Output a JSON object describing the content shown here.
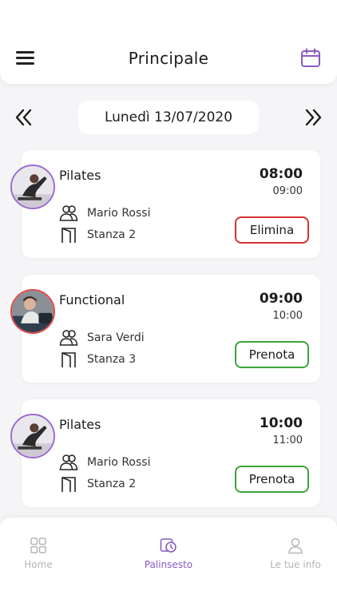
{
  "header": {
    "title": "Principale",
    "menu_icon": "hamburger-menu-icon",
    "calendar_icon": "calendar-icon"
  },
  "date_nav": {
    "date": "Lunedì 13/07/2020",
    "prev_icon": "double-chevron-left-icon",
    "next_icon": "double-chevron-right-icon"
  },
  "classes": [
    {
      "name": "Pilates",
      "start": "08:00",
      "end": "09:00",
      "trainer": "Mario Rossi",
      "room": "Stanza 2",
      "action": "Elimina",
      "action_color": "#d63333",
      "avatar_ring": "#9b6bd0"
    },
    {
      "name": "Functional",
      "start": "09:00",
      "end": "10:00",
      "trainer": "Sara Verdi",
      "room": "Stanza 3",
      "action": "Prenota",
      "action_color": "#3da33a",
      "avatar_ring": "#e04848"
    },
    {
      "name": "Pilates",
      "start": "10:00",
      "end": "11:00",
      "trainer": "Mario Rossi",
      "room": "Stanza 2",
      "action": "Prenota",
      "action_color": "#3da33a",
      "avatar_ring": "#9b6bd0"
    }
  ],
  "tabbar": {
    "items": [
      {
        "label": "Home",
        "icon": "grid-icon",
        "active": false
      },
      {
        "label": "Palinsesto",
        "icon": "schedule-icon",
        "active": true
      },
      {
        "label": "Le tue info",
        "icon": "user-icon",
        "active": false
      }
    ]
  },
  "colors": {
    "accent": "#8a5cc4",
    "delete": "#d63333",
    "book": "#3da33a",
    "background": "#f5f5f7"
  }
}
